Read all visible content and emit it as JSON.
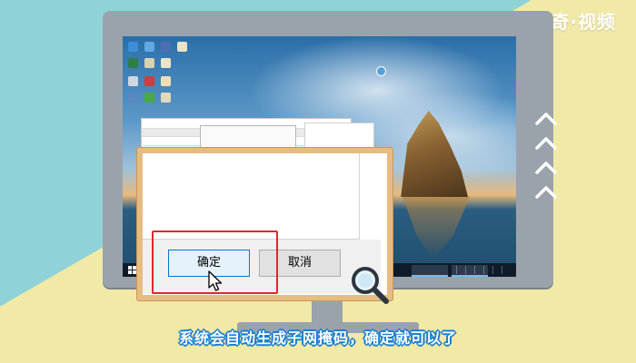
{
  "brand": "天奇·视频",
  "dialog": {
    "ok_label": "确定",
    "cancel_label": "取消"
  },
  "caption": "系统会自动生成子网掩码，确定就可以了",
  "colors": {
    "highlight": "#e0282c",
    "caption_outline": "#1b7fd0",
    "board": "#e6bc83",
    "monitor": "#9aa3ab"
  },
  "icons": [
    "cursor-arrow-icon",
    "magnifier-icon",
    "chevron-up-icon",
    "windows-start-icon"
  ]
}
